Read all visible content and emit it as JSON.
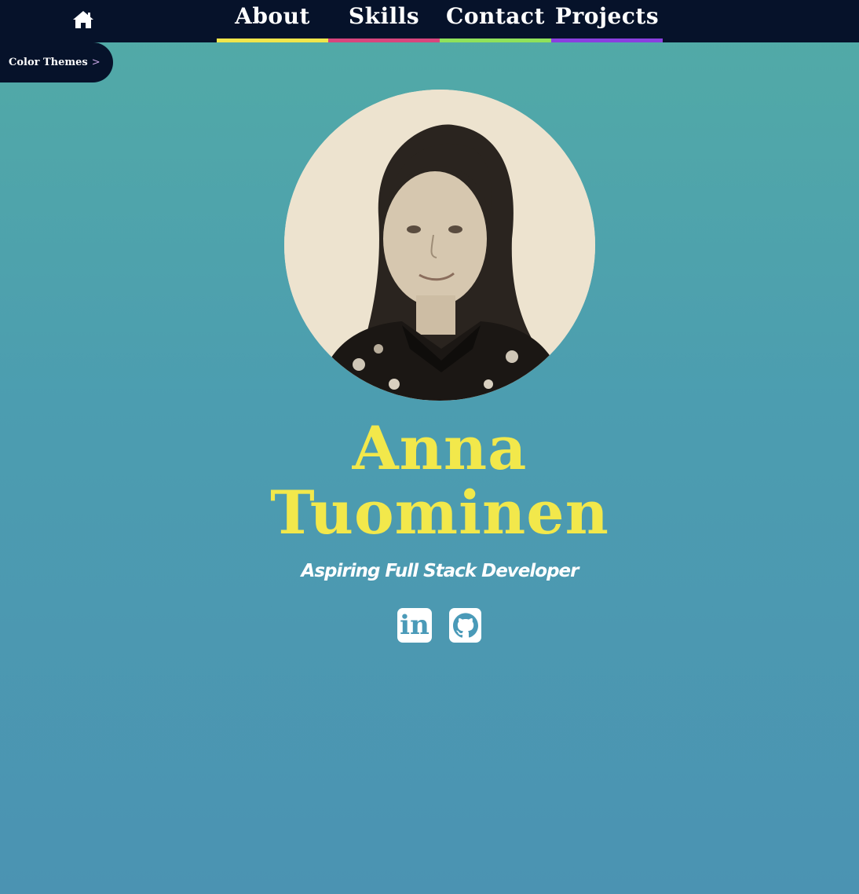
{
  "nav": {
    "home_icon": "home-icon",
    "tabs": [
      {
        "label": "About",
        "color": "#f0e64a"
      },
      {
        "label": "Skills",
        "color": "#d8457d"
      },
      {
        "label": "Contact",
        "color": "#8fe25a"
      },
      {
        "label": "Projects",
        "color": "#8a3fe0"
      }
    ]
  },
  "themes": {
    "label": "Color Themes",
    "chevron": ">"
  },
  "profile": {
    "avatar_icon": "profile-photo",
    "first_name": "Anna",
    "last_name": "Tuominen",
    "tagline": "Aspiring Full Stack Developer"
  },
  "social": {
    "linkedin_label": "in",
    "linkedin_icon": "linkedin-icon",
    "github_icon": "github-icon"
  },
  "colors": {
    "nav_bg": "#06122a",
    "name": "#f2e84b",
    "bg_top": "#52aba6",
    "bg_bottom": "#4b93b2"
  }
}
